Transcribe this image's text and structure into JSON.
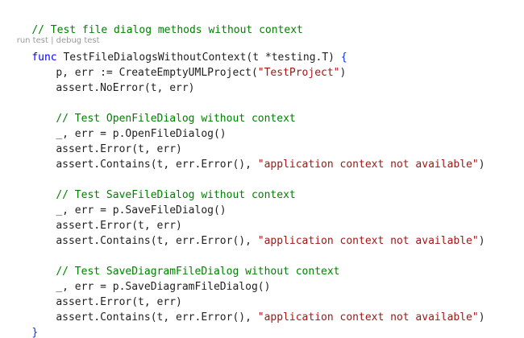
{
  "colors": {
    "comment": "#008000",
    "keyword": "#0000ff",
    "string": "#a31515",
    "text": "#1f1f1f",
    "codelens": "#999999",
    "background": "#ffffff"
  },
  "codelens": {
    "run_test": "run test",
    "separator": " | ",
    "debug_test": "debug test"
  },
  "code": {
    "line1_comment": "// Test file dialog methods without context",
    "func_kw": "func",
    "func_sig": " TestFileDialogsWithoutContext(t *testing.T) ",
    "open_brace": "{",
    "l3": "p, err := CreateEmptyUMLProject(",
    "l3_str": "\"TestProject\"",
    "l3_end": ")",
    "l4": "assert.NoError(t, err)",
    "c1": "// Test OpenFileDialog without context",
    "o1": "_, err = p.OpenFileDialog()",
    "o2": "assert.Error(t, err)",
    "o3a": "assert.Contains(t, err.Error(), ",
    "o3s": "\"application context not available\"",
    "o3b": ")",
    "c2": "// Test SaveFileDialog without context",
    "s1": "_, err = p.SaveFileDialog()",
    "s2": "assert.Error(t, err)",
    "s3a": "assert.Contains(t, err.Error(), ",
    "s3s": "\"application context not available\"",
    "s3b": ")",
    "c3": "// Test SaveDiagramFileDialog without context",
    "d1": "_, err = p.SaveDiagramFileDialog()",
    "d2": "assert.Error(t, err)",
    "d3a": "assert.Contains(t, err.Error(), ",
    "d3s": "\"application context not available\"",
    "d3b": ")",
    "close_brace": "}"
  }
}
